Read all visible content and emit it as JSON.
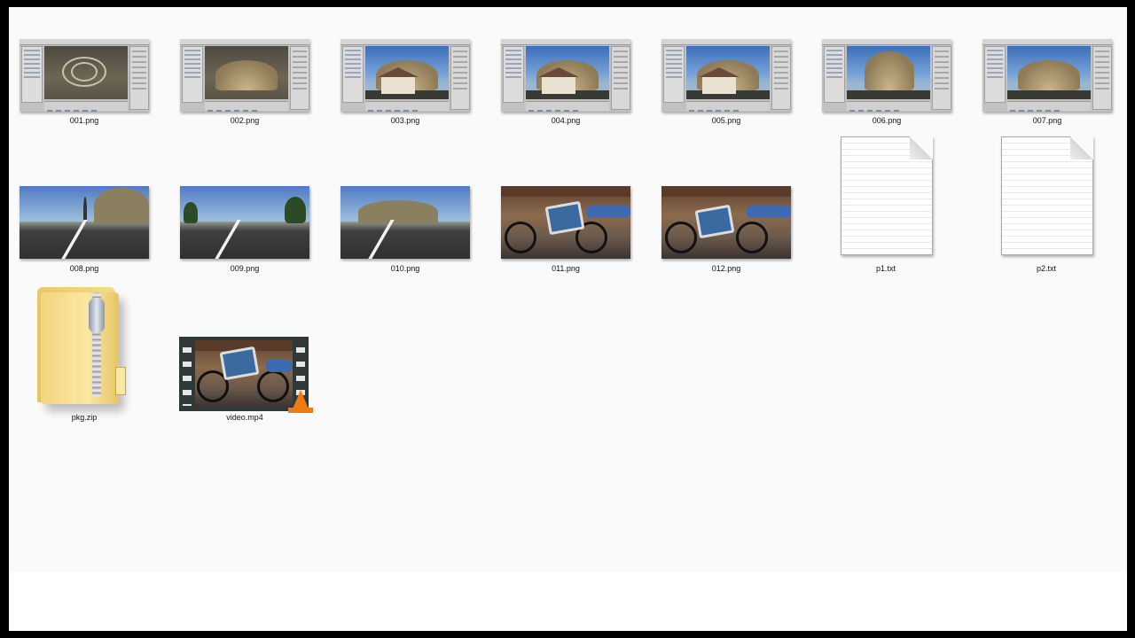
{
  "files": [
    {
      "id": "f1",
      "name": "001.png",
      "kind": "editor-dark"
    },
    {
      "id": "f2",
      "name": "002.png",
      "kind": "editor-dark"
    },
    {
      "id": "f3",
      "name": "003.png",
      "kind": "editor-house"
    },
    {
      "id": "f4",
      "name": "004.png",
      "kind": "editor-house"
    },
    {
      "id": "f5",
      "name": "005.png",
      "kind": "editor-house"
    },
    {
      "id": "f6",
      "name": "006.png",
      "kind": "editor-mountain"
    },
    {
      "id": "f7",
      "name": "007.png",
      "kind": "editor-mountain"
    },
    {
      "id": "f8",
      "name": "008.png",
      "kind": "road"
    },
    {
      "id": "f9",
      "name": "009.png",
      "kind": "road"
    },
    {
      "id": "f10",
      "name": "010.png",
      "kind": "road"
    },
    {
      "id": "f11",
      "name": "011.png",
      "kind": "photo"
    },
    {
      "id": "f12",
      "name": "012.png",
      "kind": "photo"
    },
    {
      "id": "f13",
      "name": "p1.txt",
      "kind": "text-file-icon"
    },
    {
      "id": "f14",
      "name": "p2.txt",
      "kind": "text-file-icon"
    },
    {
      "id": "f15",
      "name": "pkg.zip",
      "kind": "zip-folder-icon"
    },
    {
      "id": "f16",
      "name": "video.mp4",
      "kind": "video-file-icon"
    }
  ],
  "colors": {
    "frame": "#000000",
    "background": "#fafafa",
    "video_badge": "#f07a12"
  }
}
